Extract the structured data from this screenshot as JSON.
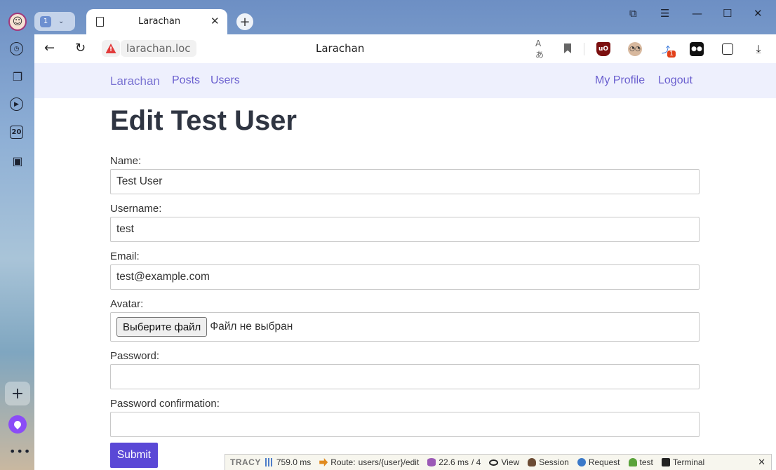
{
  "browser": {
    "tab_group_count": "1",
    "tab_title": "Larachan",
    "address_domain": "larachan.loc",
    "page_title": "Larachan",
    "extension_badge": "1",
    "sidebar_calendar_day": "20"
  },
  "site_nav": {
    "brand": "Larachan",
    "links": [
      "Posts",
      "Users"
    ],
    "right_links": [
      "My Profile",
      "Logout"
    ]
  },
  "form": {
    "heading": "Edit Test User",
    "name_label": "Name:",
    "name_value": "Test User",
    "username_label": "Username:",
    "username_value": "test",
    "email_label": "Email:",
    "email_value": "test@example.com",
    "avatar_label": "Avatar:",
    "file_button": "Выберите файл",
    "file_status": "Файл не выбран",
    "password_label": "Password:",
    "password_value": "",
    "password_confirmation_label": "Password confirmation:",
    "password_confirmation_value": "",
    "submit_label": "Submit"
  },
  "tracy": {
    "logo": "TRACY",
    "time": "759.0 ms",
    "route_label": "Route:",
    "route": "users/{user}/edit",
    "db_time": "22.6 ms",
    "db_queries": "/ 4",
    "view": "View",
    "session": "Session",
    "request": "Request",
    "user": "test",
    "terminal": "Terminal"
  }
}
